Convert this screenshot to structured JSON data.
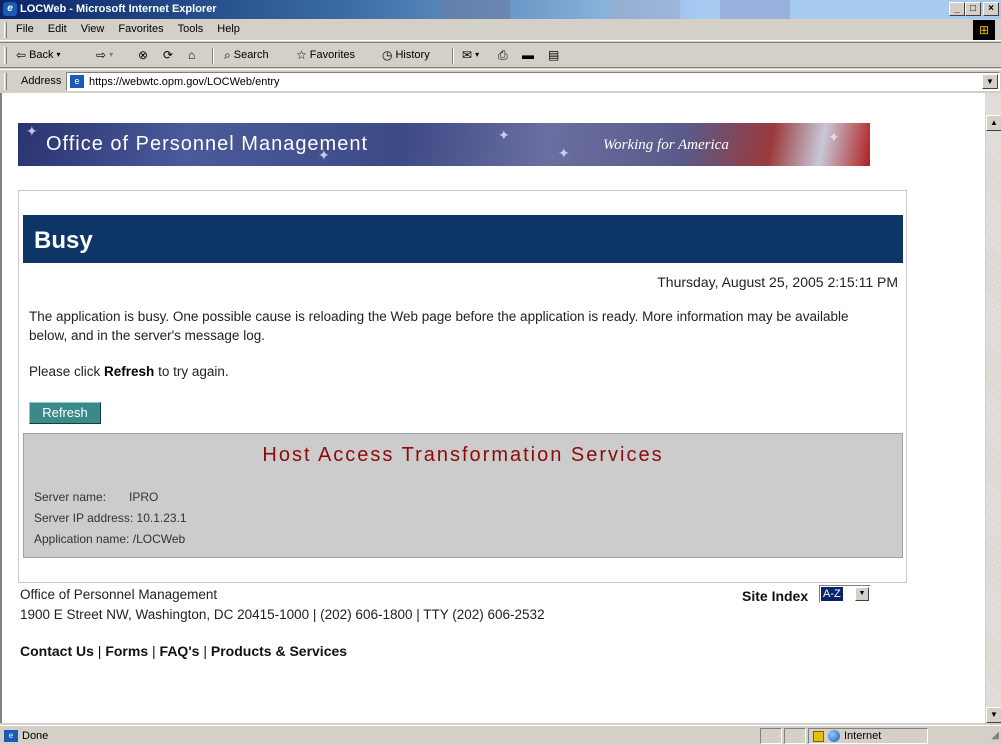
{
  "window": {
    "title": "LOCWeb - Microsoft Internet Explorer",
    "min_label": "_",
    "max_label": "□",
    "close_label": "×"
  },
  "menu": [
    "File",
    "Edit",
    "View",
    "Favorites",
    "Tools",
    "Help"
  ],
  "toolbar": {
    "back": "Back",
    "search": "Search",
    "favorites": "Favorites",
    "history": "History"
  },
  "address": {
    "label": "Address",
    "url": "https://webwtc.opm.gov/LOCWeb/entry"
  },
  "banner": {
    "title": "Office of Personnel Management",
    "slogan": "Working for America"
  },
  "page": {
    "heading": "Busy",
    "timestamp": "Thursday, August 25, 2005 2:15:11 PM",
    "message": "The application is busy.  One possible cause is reloading the Web page before the application is ready.  More information may be available below, and in the server's message log.",
    "click_prefix": "Please click ",
    "click_bold": "Refresh",
    "click_suffix": " to try again.",
    "refresh_button": "Refresh"
  },
  "hats": {
    "title": "Host Access Transformation Services",
    "server_name_label": "Server name:",
    "server_name": "IPRO",
    "server_ip_label": "Server IP address:",
    "server_ip": "10.1.23.1",
    "app_name_label": "Application name:",
    "app_name": "/LOCWeb"
  },
  "footer": {
    "org": "Office of Personnel Management",
    "address": "1900 E Street NW, Washington, DC 20415-1000 | (202) 606-1800 | TTY (202) 606-2532",
    "site_index": "Site Index",
    "site_index_value": "A-Z",
    "links": [
      "Contact Us",
      "Forms",
      "FAQ's",
      "Products & Services"
    ]
  },
  "status": {
    "text": "Done",
    "zone": "Internet"
  },
  "colors": {
    "busy_bar": "#0d3565",
    "hats_title": "#8b0a0a",
    "refresh_button": "#3a8a8a"
  }
}
